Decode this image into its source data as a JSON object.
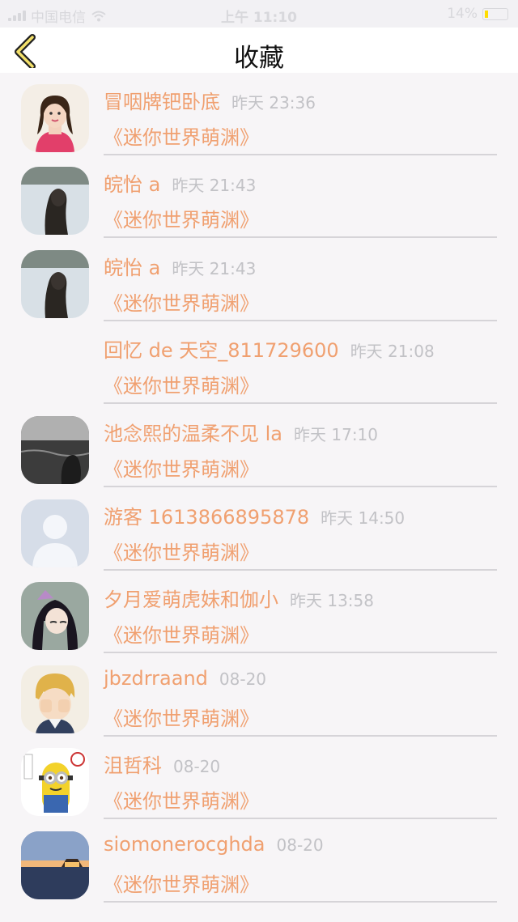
{
  "status_bar": {
    "carrier": "中国电信",
    "time": "上午 11:10",
    "battery": "14%",
    "battery_level": 0.14
  },
  "nav": {
    "title": "收藏"
  },
  "colors": {
    "accent": "#f0a070",
    "time": "#c2c2c6",
    "divider": "#d6d4d8"
  },
  "items": [
    {
      "name": "",
      "time": "",
      "message": "《迷你世界萌渊》",
      "avatar": "girl-face-photo"
    },
    {
      "name": "冒咽牌钯卧底",
      "time": "昨天 23:36",
      "message": "《迷你世界萌渊》",
      "avatar": "woman-pink-photo"
    },
    {
      "name": "皖怡 a",
      "time": "昨天 21:43",
      "message": "《迷你世界萌渊》",
      "avatar": "lake-girl-photo"
    },
    {
      "name": "皖怡 a",
      "time": "昨天 21:43",
      "message": "《迷你世界萌渊》",
      "avatar": "lake-girl-photo"
    },
    {
      "name": "回忆 de 天空_811729600",
      "time": "昨天 21:08",
      "message": "《迷你世界萌渊》",
      "avatar": "none"
    },
    {
      "name": "池念熙的温柔不见 la",
      "time": "昨天 17:10",
      "message": "《迷你世界萌渊》",
      "avatar": "dark-water-photo"
    },
    {
      "name": "游客 1613866895878",
      "time": "昨天 14:50",
      "message": "《迷你世界萌渊》",
      "avatar": "default-person"
    },
    {
      "name": "夕月爱萌虎妹和伽小",
      "time": "昨天 13:58",
      "message": "《迷你世界萌渊》",
      "avatar": "anime-girl"
    },
    {
      "name": "jbzdrraand",
      "time": "08-20",
      "message": "《迷你世界萌渊》",
      "avatar": "anime-boy"
    },
    {
      "name": "沮哲科",
      "time": "08-20",
      "message": "《迷你世界萌渊》",
      "avatar": "minion"
    },
    {
      "name": "siomonerocghda",
      "time": "08-20",
      "message": "《迷你世界萌渊》",
      "avatar": "sunset-pier"
    }
  ]
}
